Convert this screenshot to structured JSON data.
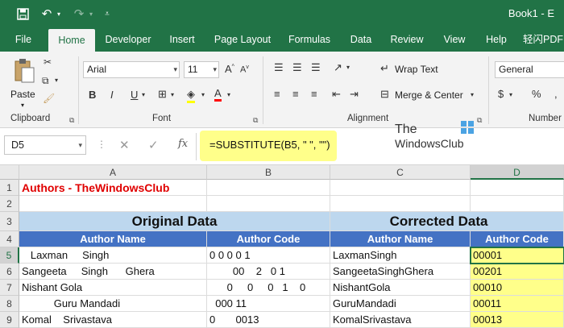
{
  "window": {
    "title": "Book1 - E"
  },
  "quick_access": {
    "save_icon": "save-icon",
    "undo_icon": "undo-icon",
    "redo_icon": "redo-icon",
    "customize_icon": "customize-qat-icon"
  },
  "tabs": [
    {
      "label": "File"
    },
    {
      "label": "Home"
    },
    {
      "label": "Developer"
    },
    {
      "label": "Insert"
    },
    {
      "label": "Page Layout"
    },
    {
      "label": "Formulas"
    },
    {
      "label": "Data"
    },
    {
      "label": "Review"
    },
    {
      "label": "View"
    },
    {
      "label": "Help"
    },
    {
      "label": "轻闪PDF"
    }
  ],
  "ribbon": {
    "clipboard": {
      "paste": "Paste",
      "label": "Clipboard"
    },
    "font": {
      "name": "Arial",
      "size": "11",
      "bold": "B",
      "italic": "I",
      "underline": "U",
      "label": "Font"
    },
    "alignment": {
      "wrap": "Wrap Text",
      "merge": "Merge & Center",
      "label": "Alignment"
    },
    "number": {
      "format": "General",
      "currency": "$",
      "percent": "%",
      "label": "Number"
    }
  },
  "formula_bar": {
    "name_box": "D5",
    "cancel": "✕",
    "enter": "✓",
    "fx": "fx",
    "formula": "=SUBSTITUTE(B5, \" \", \"\")"
  },
  "watermark": {
    "line1": "The",
    "line2": "WindowsClub"
  },
  "columns": [
    "A",
    "B",
    "C",
    "D"
  ],
  "rows": [
    "1",
    "2",
    "3",
    "4",
    "5",
    "6",
    "7",
    "8",
    "9"
  ],
  "sheet": {
    "a1": "Authors - TheWindowsClub",
    "original_title": "Original Data",
    "corrected_title": "Corrected Data",
    "author_name": "Author Name",
    "author_code": "Author Code",
    "data": [
      {
        "a": "   Laxman     Singh",
        "b": "0 0 0 0 1",
        "c": "LaxmanSingh",
        "d": "00001"
      },
      {
        "a": "Sangeeta     Singh      Ghera",
        "b": "        00    2   0 1",
        "c": "SangeetaSinghGhera",
        "d": "00201"
      },
      {
        "a": "Nishant Gola",
        "b": "      0     0     0   1    0",
        "c": "NishantGola",
        "d": "00010"
      },
      {
        "a": "           Guru Mandadi",
        "b": "  000 11",
        "c": "GuruMandadi",
        "d": "00011"
      },
      {
        "a": "Komal    Srivastava",
        "b": "0       0013",
        "c": "KomalSrivastava",
        "d": "00013"
      }
    ]
  }
}
